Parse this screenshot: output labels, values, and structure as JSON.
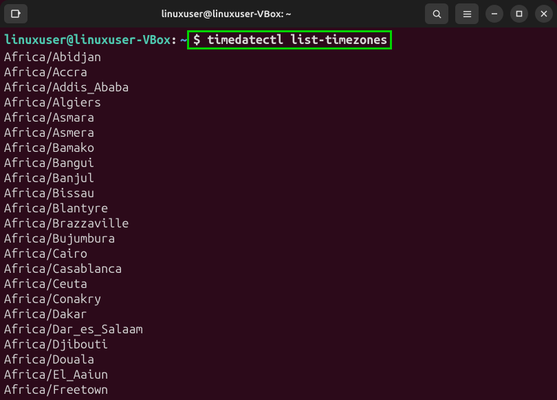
{
  "titlebar": {
    "title": "linuxuser@linuxuser-VBox: ~"
  },
  "prompt": {
    "userhost": "linuxuser@linuxuser-VBox",
    "colon": ":",
    "path": "~",
    "dollar": "$ ",
    "command": "timedatectl list-timezones"
  },
  "output": [
    "Africa/Abidjan",
    "Africa/Accra",
    "Africa/Addis_Ababa",
    "Africa/Algiers",
    "Africa/Asmara",
    "Africa/Asmera",
    "Africa/Bamako",
    "Africa/Bangui",
    "Africa/Banjul",
    "Africa/Bissau",
    "Africa/Blantyre",
    "Africa/Brazzaville",
    "Africa/Bujumbura",
    "Africa/Cairo",
    "Africa/Casablanca",
    "Africa/Ceuta",
    "Africa/Conakry",
    "Africa/Dakar",
    "Africa/Dar_es_Salaam",
    "Africa/Djibouti",
    "Africa/Douala",
    "Africa/El_Aaiun",
    "Africa/Freetown"
  ]
}
